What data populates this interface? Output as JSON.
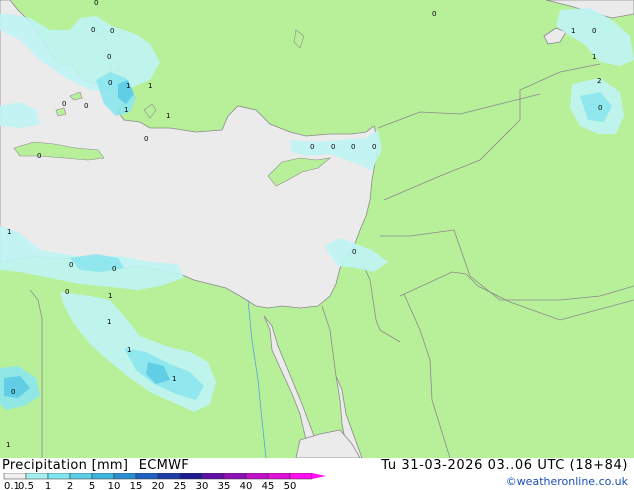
{
  "header": {
    "product": "Precipitation [mm]",
    "model": "ECMWF",
    "datetime": "Tu 31-03-2026 03..06 UTC (18+84)",
    "credit": "©weatheronline.co.uk"
  },
  "legend": {
    "values": [
      "0.1",
      "0.5",
      "1",
      "2",
      "5",
      "10",
      "15",
      "20",
      "25",
      "30",
      "35",
      "40",
      "45",
      "50"
    ],
    "colors": [
      "#f0f0f0",
      "#a4f0f0",
      "#7ee6f0",
      "#5ccfe6",
      "#3cb4dc",
      "#2c8ed0",
      "#2060c0",
      "#1c3ca8",
      "#1c1c90",
      "#6010a8",
      "#9010b8",
      "#c010c8",
      "#e010d8",
      "#ff10f0"
    ]
  },
  "colors": {
    "land": "#b8f09a",
    "sea": "#ebebeb",
    "border": "#8a8a8a",
    "precip_light": "#bff4f4",
    "precip_mid": "#8ce6ee",
    "precip_heavy": "#5ccbe4"
  },
  "map_labels": [
    "0",
    "0",
    "0",
    "0",
    "1",
    "1",
    "0",
    "0",
    "0",
    "0",
    "1",
    "1",
    "0",
    "0",
    "0",
    "0",
    "0",
    "0",
    "1",
    "0",
    "1",
    "2",
    "0",
    "1",
    "0",
    "0",
    "0",
    "1",
    "1",
    "1",
    "1",
    "0",
    "1",
    "0"
  ]
}
